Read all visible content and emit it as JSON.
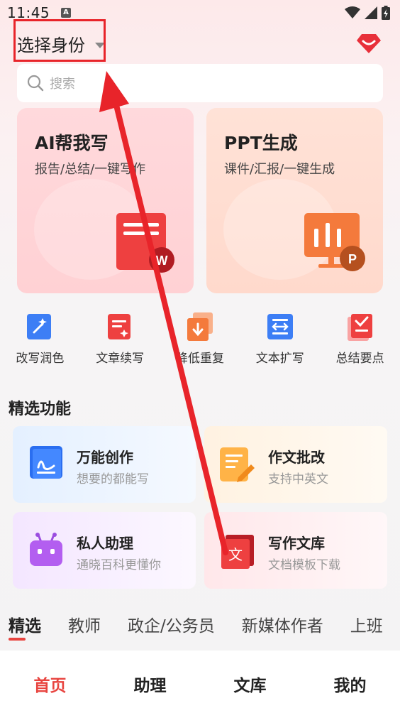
{
  "status": {
    "time": "11:45",
    "a_badge": "A"
  },
  "header": {
    "identity_label": "选择身份"
  },
  "search": {
    "placeholder": "搜索"
  },
  "cards": [
    {
      "title": "AI帮我写",
      "subtitle": "报告/总结/一键写作",
      "badge": "W"
    },
    {
      "title": "PPT生成",
      "subtitle": "课件/汇报/一键生成",
      "badge": "P"
    }
  ],
  "tools": [
    {
      "label": "改写润色",
      "icon": "magic-wand-icon"
    },
    {
      "label": "文章续写",
      "icon": "article-continue-icon"
    },
    {
      "label": "降低重复",
      "icon": "reduce-duplicate-icon"
    },
    {
      "label": "文本扩写",
      "icon": "text-expand-icon"
    },
    {
      "label": "总结要点",
      "icon": "summary-icon"
    }
  ],
  "featured": {
    "title": "精选功能",
    "items": [
      {
        "title": "万能创作",
        "subtitle": "想要的都能写",
        "icon": "pen-book-icon"
      },
      {
        "title": "作文批改",
        "subtitle": "支持中英文",
        "icon": "essay-edit-icon"
      },
      {
        "title": "私人助理",
        "subtitle": "通晓百科更懂你",
        "icon": "robot-icon"
      },
      {
        "title": "写作文库",
        "subtitle": "文档模板下载",
        "icon": "library-icon"
      }
    ]
  },
  "category_tabs": [
    "精选",
    "教师",
    "政企/公务员",
    "新媒体作者",
    "上班"
  ],
  "bottom_nav": [
    "首页",
    "助理",
    "文库",
    "我的"
  ],
  "colors": {
    "accent": "#e8443f",
    "highlight_box": "#e8242a"
  }
}
